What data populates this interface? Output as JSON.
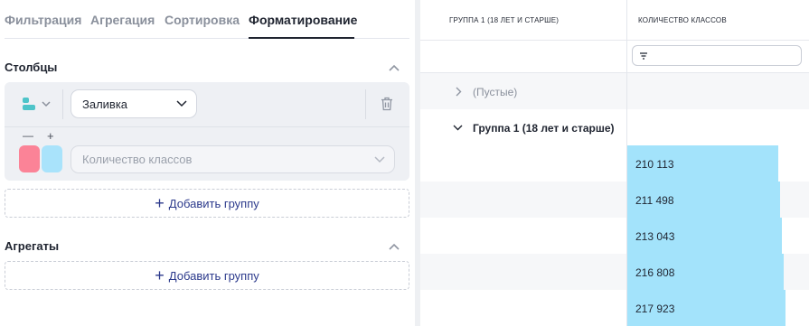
{
  "tabs": [
    {
      "label": "Фильтрация",
      "active": false
    },
    {
      "label": "Агрегация",
      "active": false
    },
    {
      "label": "Сортировка",
      "active": false
    },
    {
      "label": "Форматирование",
      "active": true
    }
  ],
  "columns_section": {
    "title": "Столбцы",
    "format_type_select": "Заливка",
    "minus_label": "—",
    "plus_label": "+",
    "column_select_placeholder": "Количество классов",
    "swatch_colors": [
      "#fb8397",
      "#a9e3fb"
    ],
    "add_group_label": "Добавить группу"
  },
  "aggregates_section": {
    "title": "Агрегаты",
    "add_group_label": "Добавить группу"
  },
  "table": {
    "headers": [
      "Группа 1 (18 лет и старше)",
      "Количество классов"
    ],
    "groups": [
      {
        "label": "(Пустые)",
        "expanded": false
      },
      {
        "label": "Группа 1 (18 лет и старше)",
        "expanded": true
      }
    ],
    "rows": [
      {
        "value": "210 113",
        "fill": 0.83
      },
      {
        "value": "211 498",
        "fill": 0.84
      },
      {
        "value": "213 043",
        "fill": 0.85
      },
      {
        "value": "216 808",
        "fill": 0.86
      },
      {
        "value": "217 923",
        "fill": 0.87
      }
    ],
    "bar_color": "#a3e3fb"
  }
}
